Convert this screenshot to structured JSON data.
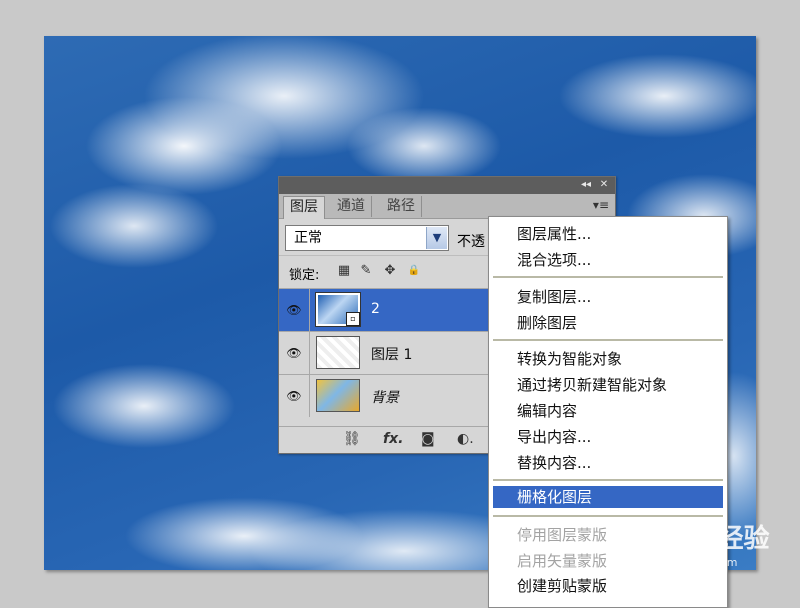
{
  "panel": {
    "tabs": [
      "图层",
      "通道",
      "路径"
    ],
    "titlebar_buttons": [
      "◂◂",
      "✕"
    ],
    "menu_button": "▾≡",
    "blend_mode": "正常",
    "opacity_label": "不透",
    "lock_label": "锁定:",
    "lock_icons": [
      "▦",
      "✎",
      "✥",
      "🔒"
    ],
    "layers": [
      {
        "name": "2",
        "selected": true,
        "thumb": "sky",
        "smart_object": true
      },
      {
        "name": "图层 1",
        "selected": false,
        "thumb": "white"
      },
      {
        "name": "背景",
        "selected": false,
        "thumb": "bg",
        "italic": true
      }
    ],
    "eye_glyph": "👁",
    "footer_icons": [
      "⛓",
      "fx.",
      "◙",
      "◐."
    ]
  },
  "menu": {
    "items": [
      {
        "label": "图层属性...",
        "state": "normal"
      },
      {
        "label": "混合选项...",
        "state": "normal"
      },
      {
        "label": "复制图层...",
        "state": "normal"
      },
      {
        "label": "删除图层",
        "state": "normal"
      },
      {
        "label": "转换为智能对象",
        "state": "normal"
      },
      {
        "label": "通过拷贝新建智能对象",
        "state": "normal"
      },
      {
        "label": "编辑内容",
        "state": "normal"
      },
      {
        "label": "导出内容...",
        "state": "normal"
      },
      {
        "label": "替换内容...",
        "state": "normal"
      },
      {
        "label": "栅格化图层",
        "state": "highlight"
      },
      {
        "label": "停用图层蒙版",
        "state": "disabled"
      },
      {
        "label": "启用矢量蒙版",
        "state": "disabled"
      },
      {
        "label": "创建剪贴蒙版",
        "state": "normal"
      }
    ]
  },
  "watermark": {
    "brand": "Bai du 经验",
    "url": "jingyan.baidu.com"
  },
  "colors": {
    "selection": "#3567c4",
    "panel_bg": "#d6d6d6",
    "titlebar": "#5d5d5d"
  }
}
